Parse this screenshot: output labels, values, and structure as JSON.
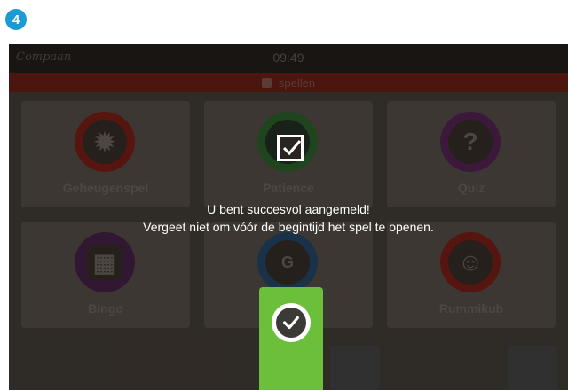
{
  "step": {
    "number": "4"
  },
  "device": {
    "app_logo": "Compaan",
    "time": "09:49",
    "section_title": "spellen"
  },
  "games": [
    {
      "label": "Geheugenspel",
      "icon": "brain-icon",
      "color": "#6b1a14"
    },
    {
      "label": "Patience",
      "icon": "cards-icon",
      "color": "#255525"
    },
    {
      "label": "Quiz",
      "icon": "question-icon",
      "color": "#4a1f49",
      "glyph": "?"
    },
    {
      "label": "Bingo",
      "icon": "bingo-card-icon",
      "color": "#3e1d3e"
    },
    {
      "label": "",
      "icon": "letter-tiles-icon",
      "color": "#1f3e5a"
    },
    {
      "label": "Rummikub",
      "icon": "face-icon",
      "color": "#6b1a14"
    }
  ],
  "dialog": {
    "line1": "U bent succesvol aangemeld!",
    "line2": "Vergeet niet om vóór de begintijd het spel te openen.",
    "confirm_icon": "check-circle-icon",
    "status_icon": "checkbox-checked-icon"
  },
  "colors": {
    "accent": "#1b9ad6",
    "confirm": "#6bbf3a",
    "title_bar": "#5b1b13"
  }
}
